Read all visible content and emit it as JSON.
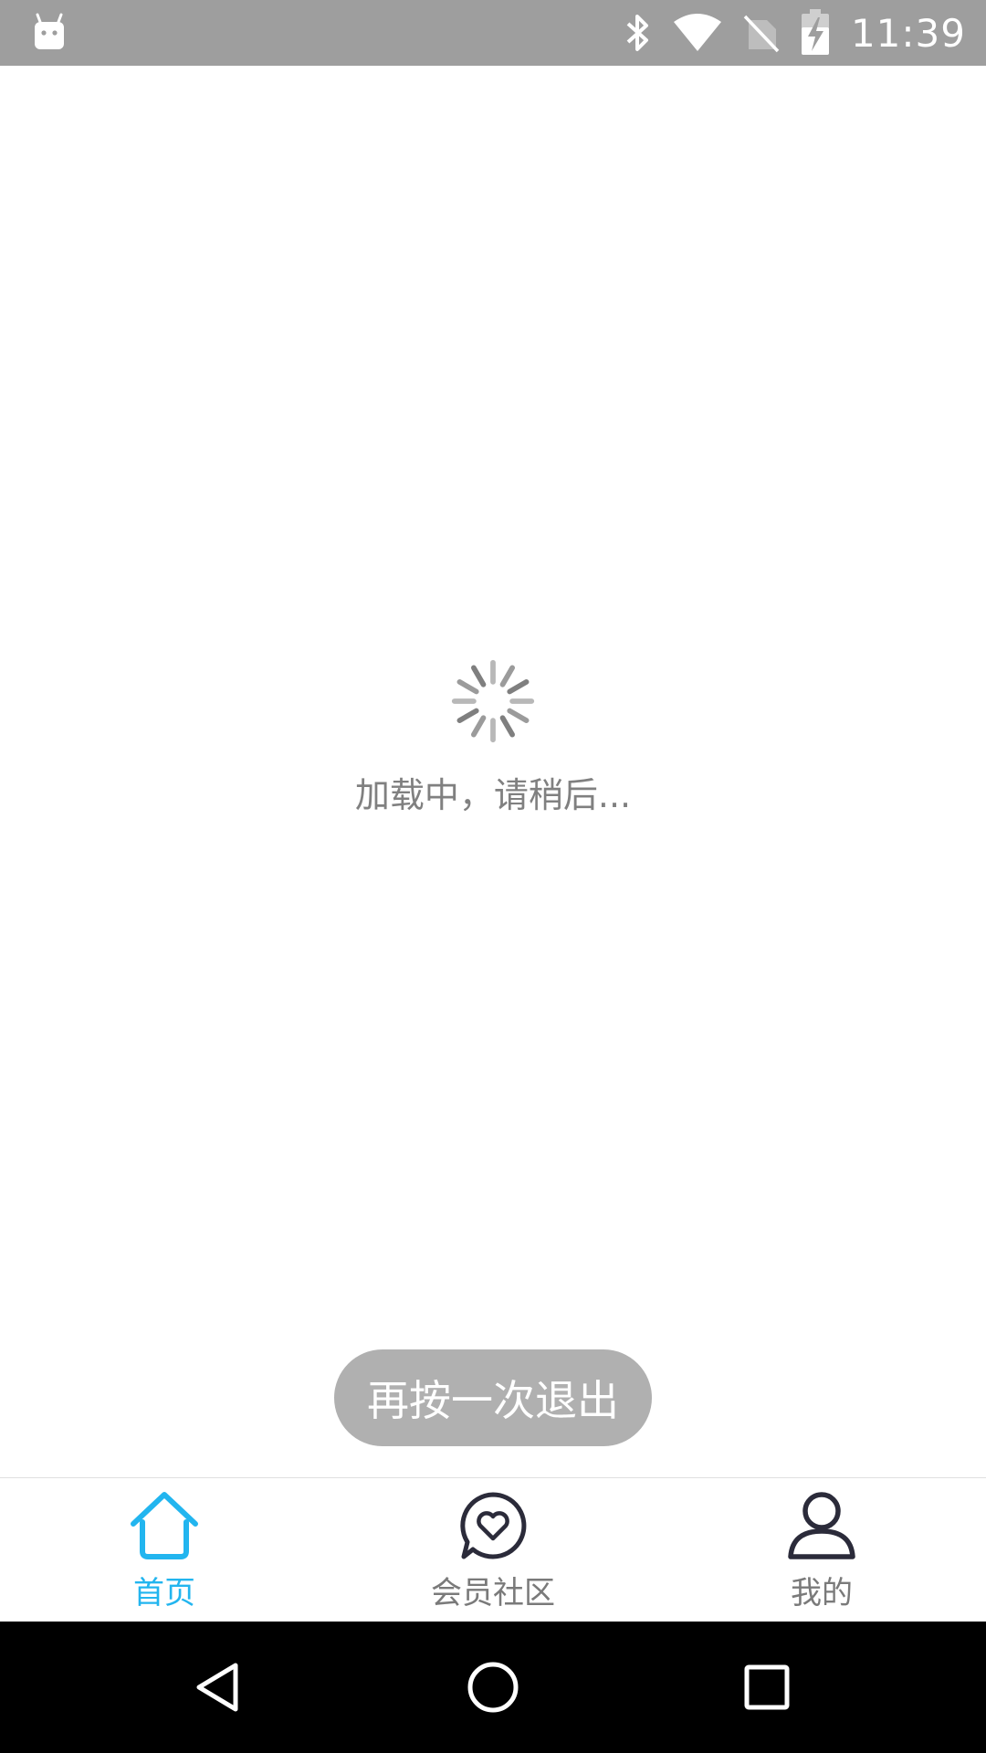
{
  "status_bar": {
    "time": "11:39",
    "icons": [
      "android-app-icon",
      "bluetooth-icon",
      "wifi-icon",
      "no-sim-icon",
      "battery-charging-icon"
    ]
  },
  "loading": {
    "text": "加载中，请稍后...",
    "icon": "spinner-icon"
  },
  "toast": {
    "text": "再按一次退出"
  },
  "tabs": [
    {
      "label": "首页",
      "icon": "home-icon",
      "active": true
    },
    {
      "label": "会员社区",
      "icon": "chat-heart-icon",
      "active": false
    },
    {
      "label": "我的",
      "icon": "person-icon",
      "active": false
    }
  ],
  "colors": {
    "accent": "#22b5ef",
    "status_bar": "#9e9e9e",
    "tab_inactive": "#7a7a7a",
    "icon_dark": "#2b2b3a",
    "toast_bg": "#b0b0b0"
  },
  "nav_bar": {
    "buttons": [
      "back-icon",
      "home-circle-icon",
      "recents-icon"
    ]
  }
}
